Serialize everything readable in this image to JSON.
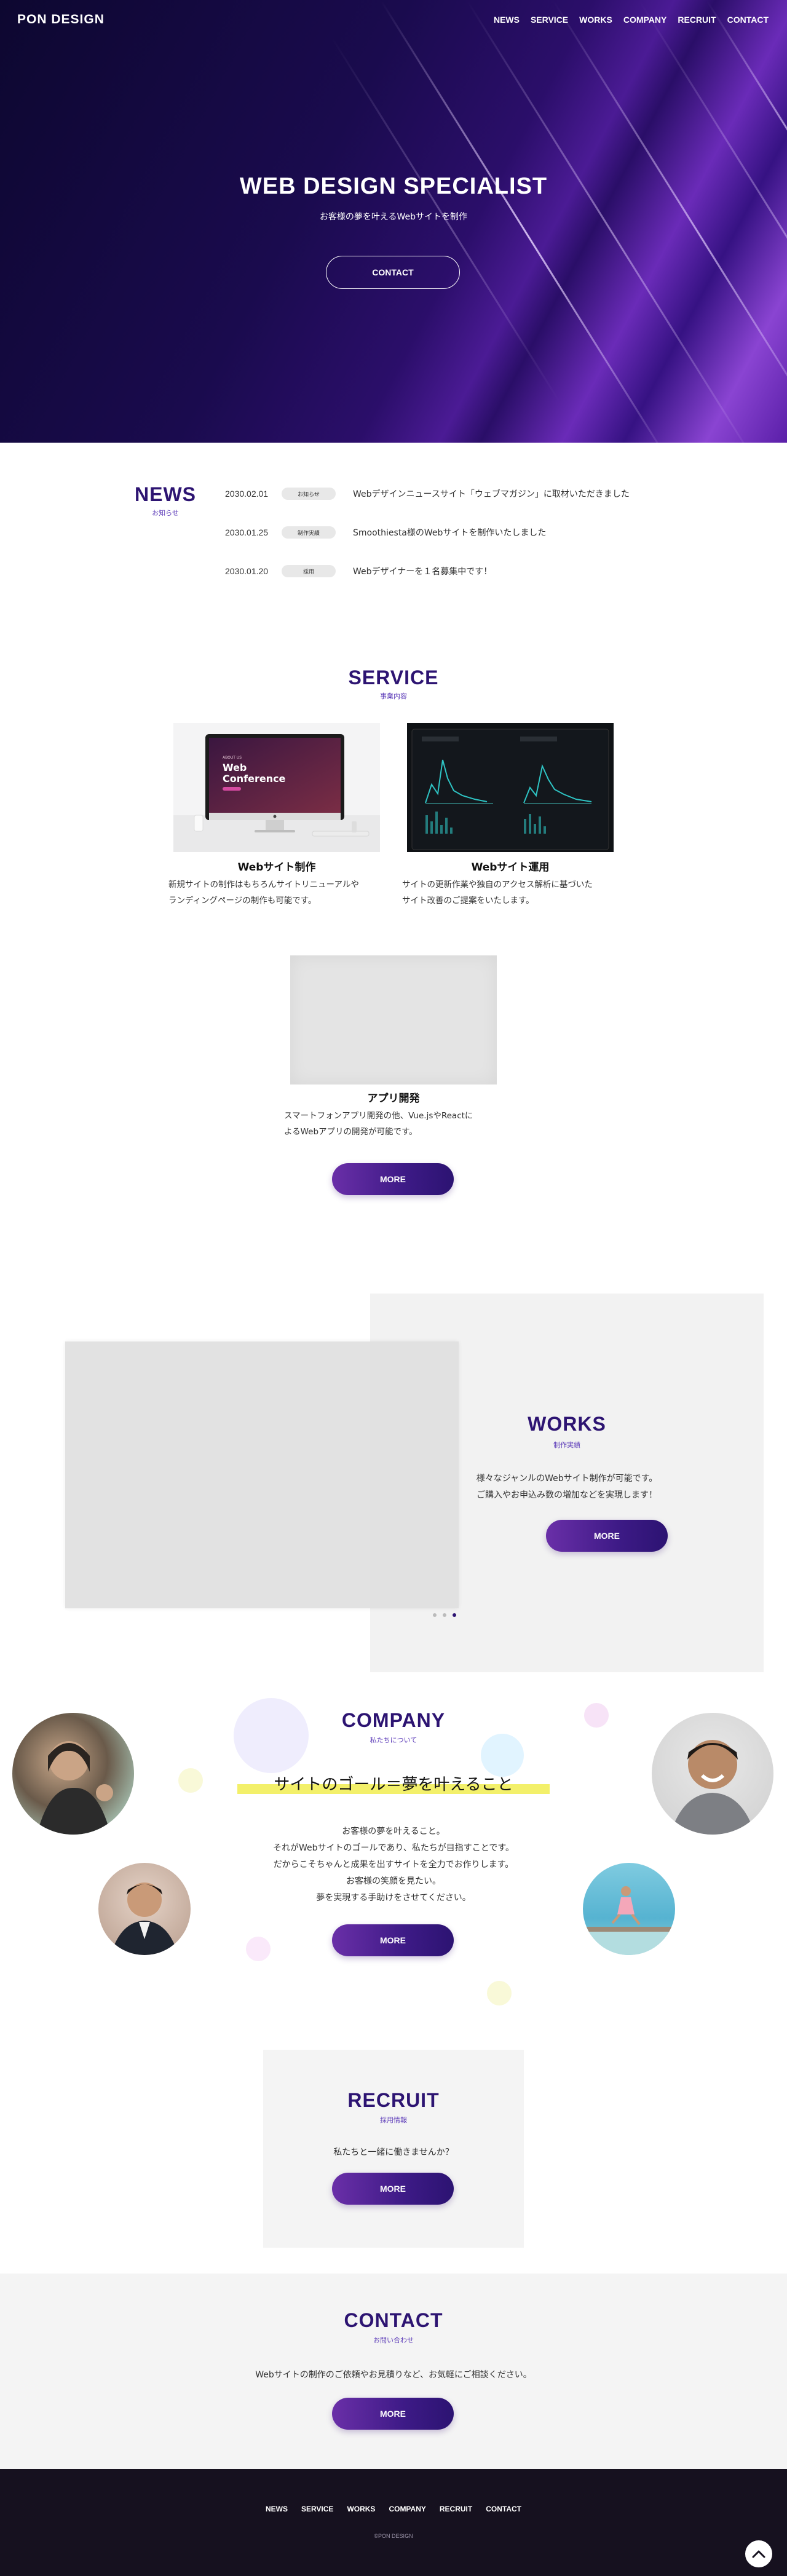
{
  "header": {
    "logo": "PON DESIGN",
    "nav": [
      "NEWS",
      "SERVICE",
      "WORKS",
      "COMPANY",
      "RECRUIT",
      "CONTACT"
    ]
  },
  "hero": {
    "title": "WEB DESIGN SPECIALIST",
    "subtitle": "お客様の夢を叶えるWebサイトを制作",
    "button": "CONTACT"
  },
  "news": {
    "title": "NEWS",
    "subtitle": "お知らせ",
    "items": [
      {
        "date": "2030.02.01",
        "badge": "お知らせ",
        "text": "Webデザインニュースサイト「ウェブマガジン」に取材いただきました"
      },
      {
        "date": "2030.01.25",
        "badge": "制作実績",
        "text": "Smoothiesta様のWebサイトを制作いたしました"
      },
      {
        "date": "2030.01.20",
        "badge": "採用",
        "text": "Webデザイナーを１名募集中です！"
      }
    ]
  },
  "service": {
    "title": "SERVICE",
    "subtitle": "事業内容",
    "cards": [
      {
        "title": "Webサイト制作",
        "desc1": "新規サイトの制作はもちろんサイトリニューアルや",
        "desc2": "ランディングページの制作も可能です。",
        "screen_label_small": "ABOUT US",
        "screen_label_1": "Web",
        "screen_label_2": "Conference"
      },
      {
        "title": "Webサイト運用",
        "desc1": "サイトの更新作業や独自のアクセス解析に基づいた",
        "desc2": "サイト改善のご提案をいたします。"
      },
      {
        "title": "アプリ開発",
        "desc1": "スマートフォンアプリ開発の他、Vue.jsやReactに",
        "desc2": "よるWebアプリの開発が可能です。"
      }
    ],
    "more": "MORE"
  },
  "works": {
    "title": "WORKS",
    "subtitle": "制作実績",
    "desc1": "様々なジャンルのWebサイト制作が可能です。",
    "desc2": "ご購入やお申込み数の増加などを実現します！",
    "more": "MORE",
    "slides_total": 3,
    "slide_active": 3
  },
  "company": {
    "title": "COMPANY",
    "subtitle": "私たちについて",
    "catch": "サイトのゴール＝夢を叶えること",
    "lines": [
      "お客様の夢を叶えること。",
      "それがWebサイトのゴールであり、私たちが目指すことです。",
      "だからこそちゃんと成果を出すサイトを全力でお作りします。",
      "お客様の笑顔を見たい。",
      "夢を実現する手助けをさせてください。"
    ],
    "more": "MORE"
  },
  "recruit": {
    "title": "RECRUIT",
    "subtitle": "採用情報",
    "text": "私たちと一緒に働きませんか？",
    "more": "MORE"
  },
  "contact": {
    "title": "CONTACT",
    "subtitle": "お問い合わせ",
    "text": "Webサイトの制作のご依頼やお見積りなど、お気軽にご相談ください。",
    "more": "MORE"
  },
  "footer": {
    "nav": [
      "NEWS",
      "SERVICE",
      "WORKS",
      "COMPANY",
      "RECRUIT",
      "CONTACT"
    ],
    "copyright": "©PON DESIGN"
  },
  "colors": {
    "brand_purple": "#2d1472",
    "accent_purple": "#5b3ab8",
    "highlight_yellow": "#f3f06a",
    "footer_bg": "#16111f"
  }
}
